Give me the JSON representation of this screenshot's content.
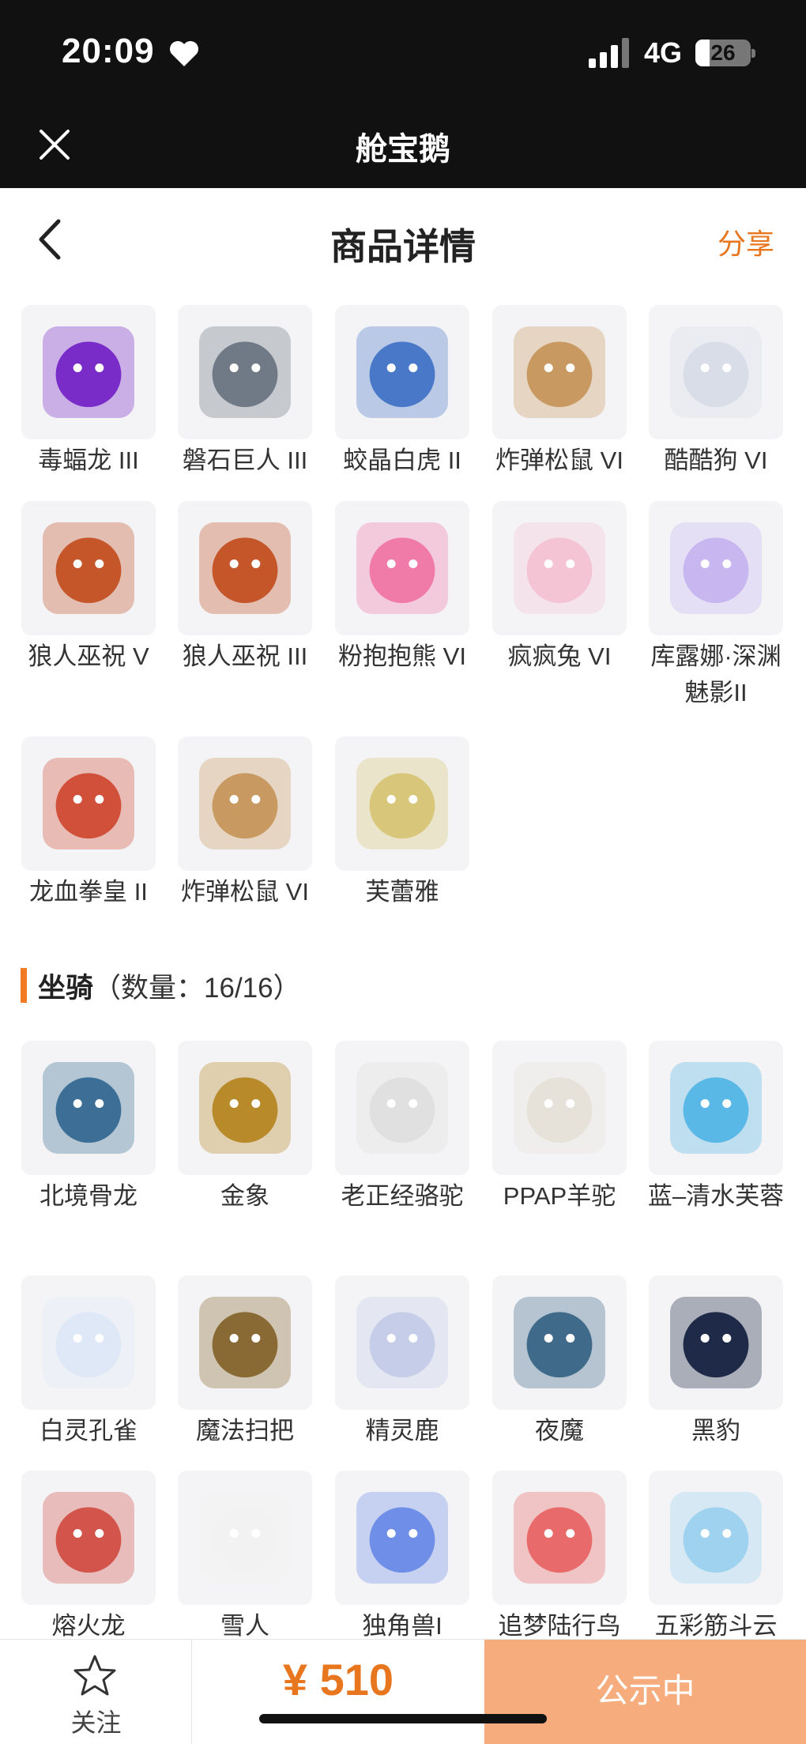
{
  "status_bar": {
    "time": "20:09",
    "network": "4G",
    "battery": "26"
  },
  "app_bar": {
    "title": "舱宝鹅"
  },
  "page_header": {
    "title": "商品详情",
    "share": "分享"
  },
  "items_top": [
    {
      "name": "毒蝠龙 III",
      "icon": "dragon-icon",
      "color": "#7a2cc9"
    },
    {
      "name": "磐石巨人 III",
      "icon": "golem-icon",
      "color": "#6f7a86"
    },
    {
      "name": "蛟晶白虎 II",
      "icon": "tiger-icon",
      "color": "#4a78c8"
    },
    {
      "name": "炸弹松鼠 VI",
      "icon": "squirrel-icon",
      "color": "#c89a62"
    },
    {
      "name": "酷酷狗 VI",
      "icon": "dog-icon",
      "color": "#d9dde8"
    },
    {
      "name": "狼人巫祝 V",
      "icon": "werewolf-icon",
      "color": "#c4562a"
    },
    {
      "name": "狼人巫祝 III",
      "icon": "werewolf-icon",
      "color": "#c4562a"
    },
    {
      "name": "粉抱抱熊 VI",
      "icon": "bear-icon",
      "color": "#f07aa8"
    },
    {
      "name": "疯疯兔 VI",
      "icon": "rabbit-icon",
      "color": "#f4c4d4"
    },
    {
      "name": "库露娜·深渊魅影II",
      "icon": "girl-icon",
      "color": "#c7b6f0"
    },
    {
      "name": "龙血拳皇 II",
      "icon": "beast-icon",
      "color": "#d0503a"
    },
    {
      "name": "炸弹松鼠 VI",
      "icon": "squirrel-icon",
      "color": "#c89a62"
    },
    {
      "name": "芙蕾雅",
      "icon": "heroine-icon",
      "color": "#d8c77a"
    }
  ],
  "mounts_section": {
    "title": "坐骑",
    "count": "（数量：16/16）"
  },
  "mounts": [
    {
      "name": "北境骨龙",
      "icon": "dragon-icon",
      "color": "#3d6f96"
    },
    {
      "name": "金象",
      "icon": "elephant-icon",
      "color": "#b88a2a"
    },
    {
      "name": "老正经骆驼",
      "icon": "camel-icon",
      "color": "#e0e0e0"
    },
    {
      "name": "PPAP羊驼",
      "icon": "alpaca-icon",
      "color": "#e6e2da"
    },
    {
      "name": "蓝–清水芙蓉",
      "icon": "lotus-icon",
      "color": "#5ab8e6"
    },
    {
      "name": "白灵孔雀",
      "icon": "peacock-icon",
      "color": "#dfe8f6"
    },
    {
      "name": "魔法扫把",
      "icon": "broom-icon",
      "color": "#8a6a34"
    },
    {
      "name": "精灵鹿",
      "icon": "deer-icon",
      "color": "#c6cde8"
    },
    {
      "name": "夜魔",
      "icon": "horse-icon",
      "color": "#3f6a8a"
    },
    {
      "name": "黑豹",
      "icon": "panther-icon",
      "color": "#1e2a48"
    },
    {
      "name": "熔火龙",
      "icon": "dragon-icon",
      "color": "#d2544a"
    },
    {
      "name": "雪人",
      "icon": "snowman-icon",
      "color": "#f2f2f2"
    },
    {
      "name": "独角兽I",
      "icon": "unicorn-icon",
      "color": "#6f8ee8"
    },
    {
      "name": "追梦陆行鸟",
      "icon": "bird-icon",
      "color": "#e86a6a"
    },
    {
      "name": "五彩筋斗云",
      "icon": "cloud-icon",
      "color": "#9fd2ee"
    }
  ],
  "bottom_bar": {
    "favorite": "关注",
    "price": "¥ 510",
    "status": "公示中"
  }
}
